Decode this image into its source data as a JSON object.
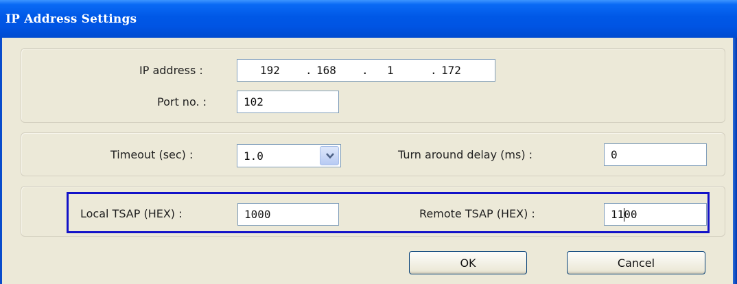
{
  "window": {
    "title": "IP Address Settings"
  },
  "ip": {
    "label": "IP address :",
    "octets": [
      "192",
      "168",
      "1",
      "172"
    ],
    "dots": [
      ".",
      ".",
      "."
    ],
    "port_label": "Port no. :",
    "port_value": "102"
  },
  "timing": {
    "timeout_label": "Timeout (sec) :",
    "timeout_value": "1.0",
    "turnaround_label": "Turn around delay (ms) :",
    "turnaround_value": "0"
  },
  "tsap": {
    "local_label": "Local TSAP (HEX) :",
    "local_value": "1000",
    "remote_label": "Remote TSAP (HEX) :",
    "remote_value": "1100"
  },
  "buttons": {
    "ok": "OK",
    "cancel": "Cancel"
  },
  "colors": {
    "title_bar": "#0054e3",
    "highlight_border": "#1212c8",
    "field_border": "#7f9db9",
    "dialog_bg": "#ece9d8"
  },
  "icons": {
    "dropdown": "chevron-down-icon"
  }
}
